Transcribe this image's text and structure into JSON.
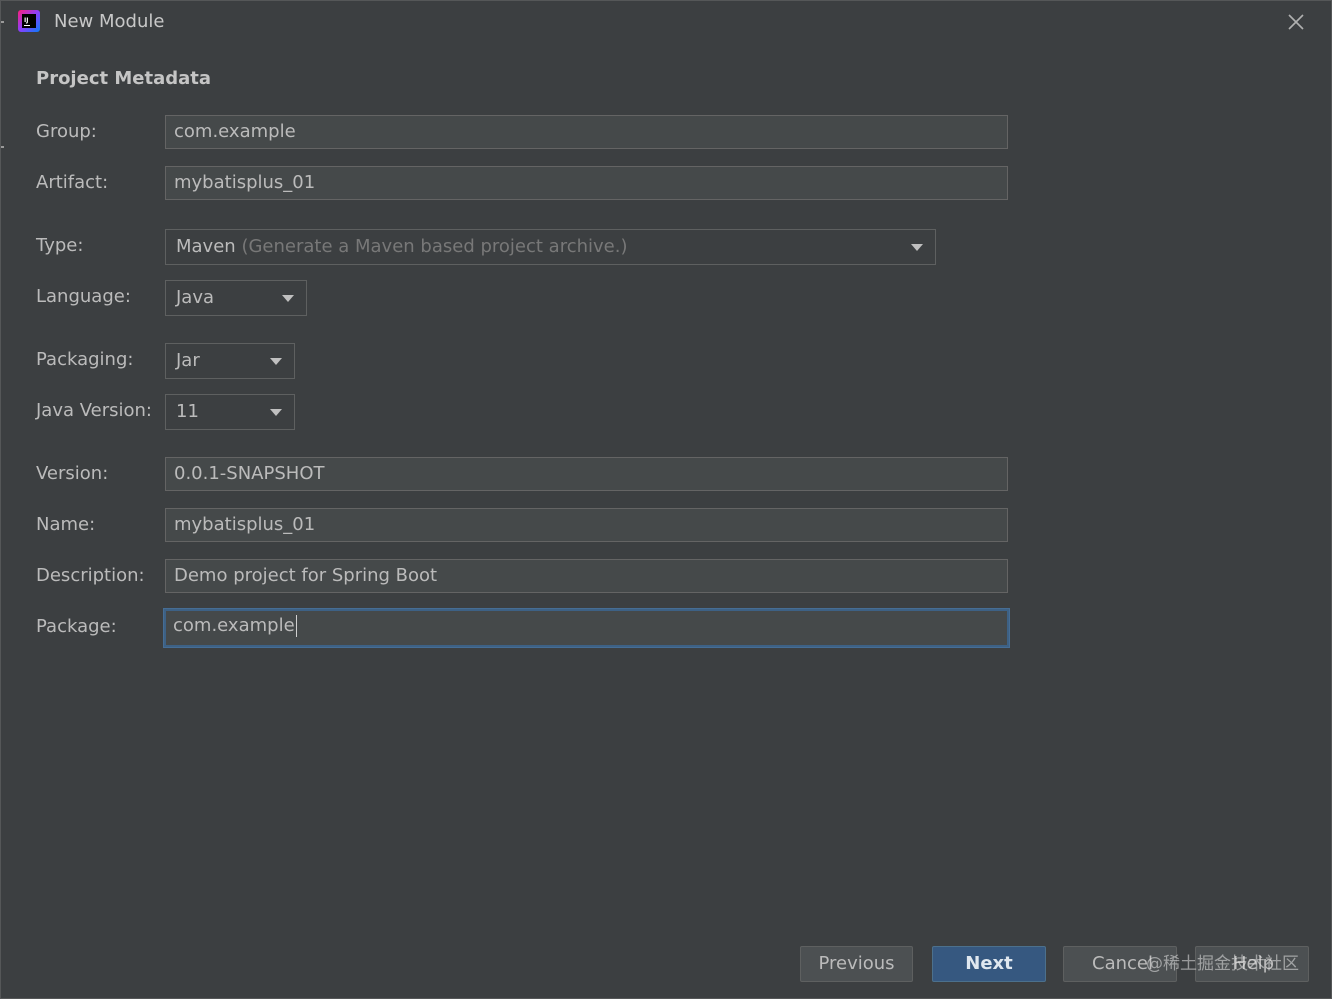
{
  "window": {
    "title": "New Module"
  },
  "section": {
    "title": "Project Metadata"
  },
  "fields": {
    "group": {
      "label": "Group:",
      "value": "com.example"
    },
    "artifact": {
      "label": "Artifact:",
      "value": "mybatisplus_01"
    },
    "type": {
      "label": "Type:",
      "value": "Maven",
      "hint": "(Generate a Maven based project archive.)"
    },
    "language": {
      "label": "Language:",
      "value": "Java"
    },
    "packaging": {
      "label": "Packaging:",
      "value": "Jar"
    },
    "java_version": {
      "label": "Java Version:",
      "value": "11"
    },
    "version": {
      "label": "Version:",
      "value": "0.0.1-SNAPSHOT"
    },
    "name": {
      "label": "Name:",
      "value": "mybatisplus_01"
    },
    "description": {
      "label": "Description:",
      "value": "Demo project for Spring Boot"
    },
    "package": {
      "label": "Package:",
      "value": "com.example"
    }
  },
  "buttons": {
    "previous": "Previous",
    "next": "Next",
    "cancel": "Cancel",
    "help": "Help"
  },
  "watermark": "@稀土掘金技术社区",
  "colors": {
    "background": "#3c3f41",
    "primary_button": "#365880",
    "focus_border": "#3d6185"
  },
  "icons": {
    "app": "intellij-idea-icon",
    "close": "close-icon",
    "dropdown": "chevron-down-icon"
  }
}
